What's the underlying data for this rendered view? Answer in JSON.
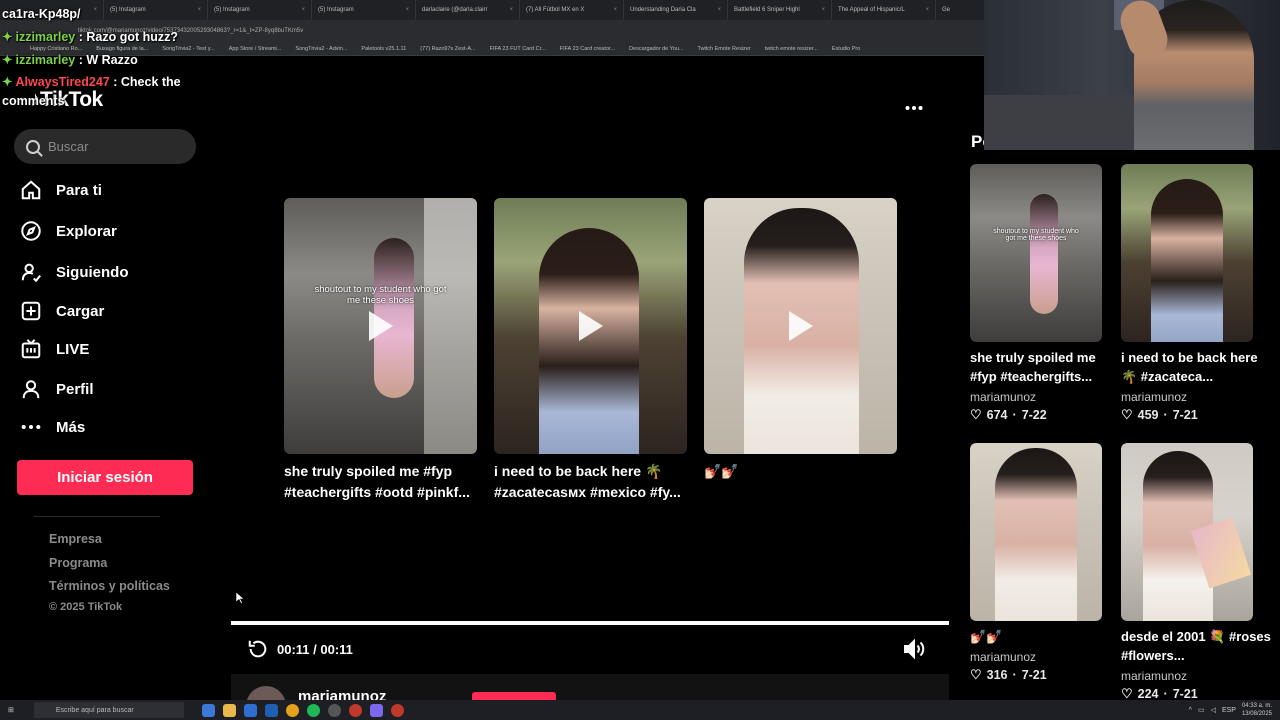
{
  "browser": {
    "tabs": [
      {
        "label": ""
      },
      {
        "label": "(5) Instagram"
      },
      {
        "label": "(5) Instagram"
      },
      {
        "label": "(5) Instagram"
      },
      {
        "label": "darlaclaire (@darla.clairr"
      },
      {
        "label": "(7) All Fútbol MX en X"
      },
      {
        "label": "Understanding Daria Cla"
      },
      {
        "label": "Battlefield 6 Sniper Highl"
      },
      {
        "label": "The Appeal of Hispanic/L"
      },
      {
        "label": "Ge"
      }
    ],
    "address": "tiktok.com/@mariamunoz/video/7537343200529304863?_r=1&_t=ZP-8yq8buTKm5v",
    "bookmarks": [
      "Happy Cristiano Ro...",
      "Busago figura de la...",
      "SongTrivia2 - Test y...",
      "App Store / Streami...",
      "SongTrivia2 - Advin...",
      "Paletools v25.1.11",
      "(77) Razo97s Zest-A...",
      "FIFA 23 FUT Card Cr...",
      "FIFA 23 Card creator...",
      "Descargador de You...",
      "Twitch Emote Resizer",
      "twitch emote resizer...",
      "Estudio Pro"
    ]
  },
  "chat": {
    "top_line": "ca1ra-Kp48p/",
    "messages": [
      {
        "user": "izzimarley",
        "text": " : Razo got huzz?",
        "color": "white"
      },
      {
        "user": "izzimarley",
        "text": " : W Razzo",
        "color": "white"
      },
      {
        "user": "AlwaysTired247",
        "text": " : Check the",
        "color": "red"
      },
      {
        "user": "",
        "text": "comments",
        "color": "white"
      }
    ]
  },
  "sidebar": {
    "logo": "TikTok",
    "search_placeholder": "Buscar",
    "nav": [
      {
        "label": "Para ti",
        "icon": "home-icon"
      },
      {
        "label": "Explorar",
        "icon": "compass-icon"
      },
      {
        "label": "Siguiendo",
        "icon": "following-icon"
      },
      {
        "label": "Cargar",
        "icon": "upload-icon"
      },
      {
        "label": "LIVE",
        "icon": "live-icon"
      },
      {
        "label": "Perfil",
        "icon": "profile-icon"
      },
      {
        "label": "Más",
        "icon": "more-icon"
      }
    ],
    "login_label": "Iniciar sesión",
    "footer": [
      "Empresa",
      "Programa",
      "Términos y políticas"
    ],
    "copyright": "© 2025 TikTok"
  },
  "main": {
    "videos": [
      {
        "caption": "she truly spoiled me #fyp #teachergifts #ootd #pinkf...",
        "overlay": "shoutout to my student who got me these shoes"
      },
      {
        "caption": "i need to be back here 🌴 #zacatecasмx #mexico #fy...",
        "overlay": ""
      },
      {
        "caption": "💅🏻💅🏻",
        "overlay": ""
      }
    ],
    "time": "00:11 / 00:11",
    "progress": 1.0,
    "bottom_user": "mariamunoz"
  },
  "right": {
    "title": "Po",
    "cards": [
      {
        "caption": "she truly spoiled me #fyp #teachergifts...",
        "user": "mariamunoz",
        "likes": "674",
        "date": "7-22",
        "overlay": "shoutout to my student who got me these shoes"
      },
      {
        "caption": "i need to be back here 🌴 #zacateca...",
        "user": "mariamunoz",
        "likes": "459",
        "date": "7-21",
        "overlay": ""
      },
      {
        "caption": "💅🏻💅🏻",
        "user": "mariamunoz",
        "likes": "316",
        "date": "7-21",
        "overlay": ""
      },
      {
        "caption": "desde el 2001 💐 #roses #flowers...",
        "user": "mariamunoz",
        "likes": "224",
        "date": "7-21",
        "overlay": ""
      }
    ]
  },
  "taskbar": {
    "search_placeholder": "Escribe aquí para buscar",
    "lang": "ESP",
    "time": "04:33 a. m.",
    "date": "13/08/2025"
  },
  "colors": {
    "accent": "#fe2c55",
    "background": "#000000",
    "chat_green": "#7bd24a",
    "chat_red": "#ff4650"
  }
}
